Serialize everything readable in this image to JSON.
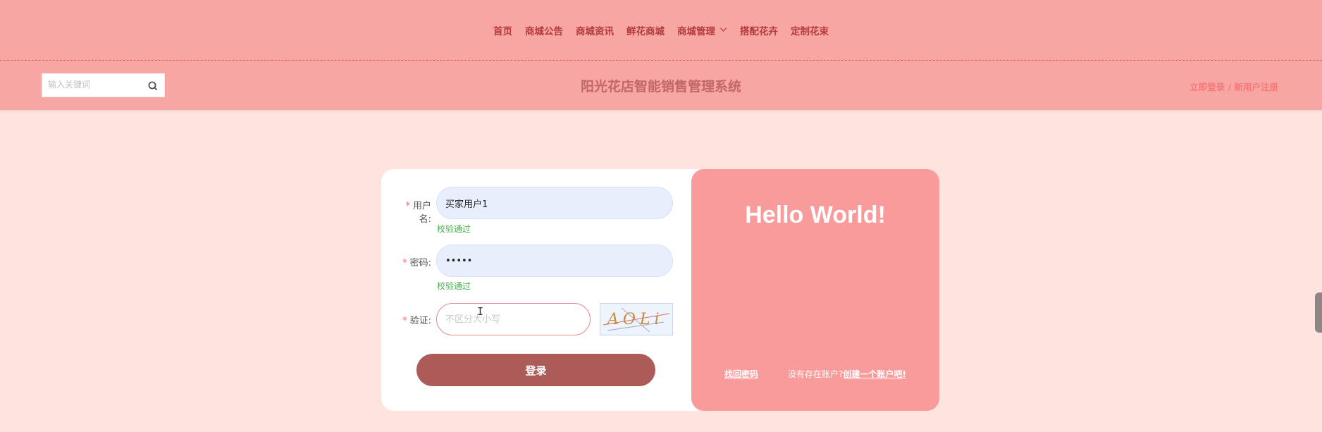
{
  "nav": {
    "items": [
      "首页",
      "商城公告",
      "商城资讯",
      "鲜花商城",
      "商城管理",
      "搭配花卉",
      "定制花束"
    ]
  },
  "search": {
    "placeholder": "输入关键词"
  },
  "header": {
    "title": "阳光花店智能销售管理系统",
    "login_link": "立即登录",
    "separator": "/",
    "register_link": "新用户注册"
  },
  "form": {
    "username": {
      "label": "用户名:",
      "value": "买家用户1",
      "valid": "校验通过"
    },
    "password": {
      "label": "密码:",
      "value": "•••••",
      "valid": "校验通过"
    },
    "captcha": {
      "label": "验证:",
      "placeholder": "不区分大小写",
      "image_text": "AOLi"
    },
    "submit_label": "登录",
    "required_mark": "*"
  },
  "promo": {
    "heading": "Hello World!",
    "forgot_password": "找回密码",
    "no_account_text": "没有存在账户?",
    "create_account": "创建一个账户吧!"
  },
  "colors": {
    "nav_bg": "#f7a6a4",
    "page_bg": "#ffe3df",
    "accent_panel": "#f99b9a",
    "button": "#ad5b59",
    "success": "#4caf50"
  }
}
